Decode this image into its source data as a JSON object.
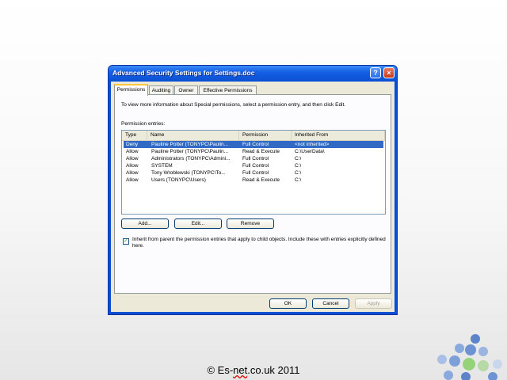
{
  "dialog": {
    "title": "Advanced Security Settings for Settings.doc",
    "help_label": "?",
    "close_label": "×"
  },
  "tabs": [
    {
      "label": "Permissions"
    },
    {
      "label": "Auditing"
    },
    {
      "label": "Owner"
    },
    {
      "label": "Effective Permissions"
    }
  ],
  "description": "To view more information about Special permissions, select a permission entry, and then click Edit.",
  "entries_label": "Permission entries:",
  "columns": [
    "Type",
    "Name",
    "Permission",
    "Inherited From"
  ],
  "rows": [
    {
      "type": "Deny",
      "name": "Pauline Potter (TONYPC\\Paulin...",
      "permission": "Full Control",
      "inherited": "<not inherited>"
    },
    {
      "type": "Allow",
      "name": "Pauline Potter (TONYPC\\Paulin...",
      "permission": "Read & Execute",
      "inherited": "C:\\UserData\\"
    },
    {
      "type": "Allow",
      "name": "Administrators (TONYPC\\Admini...",
      "permission": "Full Control",
      "inherited": "C:\\"
    },
    {
      "type": "Allow",
      "name": "SYSTEM",
      "permission": "Full Control",
      "inherited": "C:\\"
    },
    {
      "type": "Allow",
      "name": "Tony Wroblewski (TONYPC\\To...",
      "permission": "Full Control",
      "inherited": "C:\\"
    },
    {
      "type": "Allow",
      "name": "Users (TONYPC\\Users)",
      "permission": "Read & Execute",
      "inherited": "C:\\"
    }
  ],
  "buttons": {
    "add": "Add...",
    "edit": "Edit...",
    "remove": "Remove",
    "ok": "OK",
    "cancel": "Cancel",
    "apply": "Apply"
  },
  "inherit_checkbox": {
    "checked": true,
    "mark": "✓",
    "label": "Inherit from parent the permission entries that apply to child objects. Include these with entries explicitly defined here."
  },
  "footer": {
    "prefix": "© Es-",
    "underlined": "net",
    "suffix": ".co.uk 2011"
  },
  "colors": {
    "titlebar": "#0a4fd2",
    "selection": "#316ac5",
    "dialog_face": "#ece9d8"
  }
}
